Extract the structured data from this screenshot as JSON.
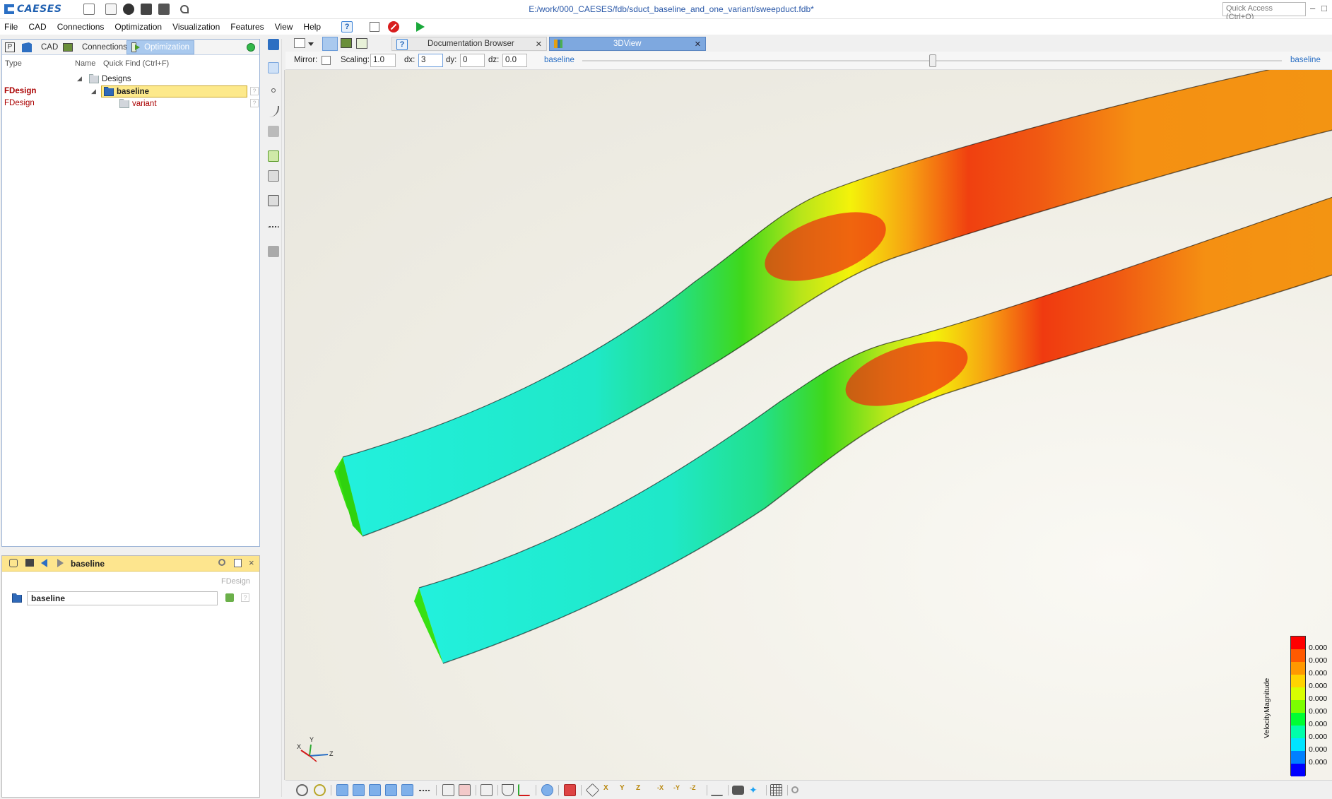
{
  "app": {
    "logo": "CAESES",
    "file_title": "E:/work/000_CAESES/fdb/sduct_baseline_and_one_variant/sweepduct.fdb*",
    "quick_access_placeholder": "Quick Access (Ctrl+Q)"
  },
  "menu": [
    "File",
    "CAD",
    "Connections",
    "Optimization",
    "Visualization",
    "Features",
    "View",
    "Help"
  ],
  "left_tabs": {
    "p_label": "P",
    "cad": "CAD",
    "connections": "Connections",
    "optimization": "Optimization"
  },
  "tree": {
    "col_type": "Type",
    "col_name": "Name",
    "quick_find": "Quick Find (Ctrl+F)",
    "root": "Designs",
    "items": [
      {
        "type": "FDesign",
        "name": "baseline",
        "selected": true
      },
      {
        "type": "FDesign",
        "name": "variant",
        "selected": false
      }
    ]
  },
  "object_editor": {
    "title": "baseline",
    "type": "FDesign",
    "name_value": "baseline"
  },
  "doc_tabs": {
    "documentation": "Documentation Browser",
    "view3d": "3DView"
  },
  "view_options": {
    "mirror_label": "Mirror:",
    "scaling_label": "Scaling:",
    "scaling_value": "1.0",
    "dx_label": "dx:",
    "dx_value": "3",
    "dy_label": "dy:",
    "dy_value": "0",
    "dz_label": "dz:",
    "dz_value": "0.0",
    "left_variant": "baseline",
    "right_variant": "baseline",
    "slider_position": 0.41
  },
  "legend": {
    "title": "VelocityMagnitude",
    "values": [
      "0.000",
      "0.000",
      "0.000",
      "0.000",
      "0.000",
      "0.000",
      "0.000",
      "0.000",
      "0.000",
      "0.000"
    ],
    "colors": [
      "#ff0000",
      "#ff5a00",
      "#ff9900",
      "#ffd400",
      "#d8ff00",
      "#7cff00",
      "#00ff33",
      "#00ffaa",
      "#00e5ff",
      "#0080ff",
      "#0000ff"
    ]
  },
  "triad": {
    "x": "X",
    "y": "Y",
    "z": "Z"
  },
  "colors": {
    "accent": "#2a6fc4",
    "tab_active": "#7ea8df",
    "selection": "#fde98b",
    "type_text": "#aa0000"
  }
}
